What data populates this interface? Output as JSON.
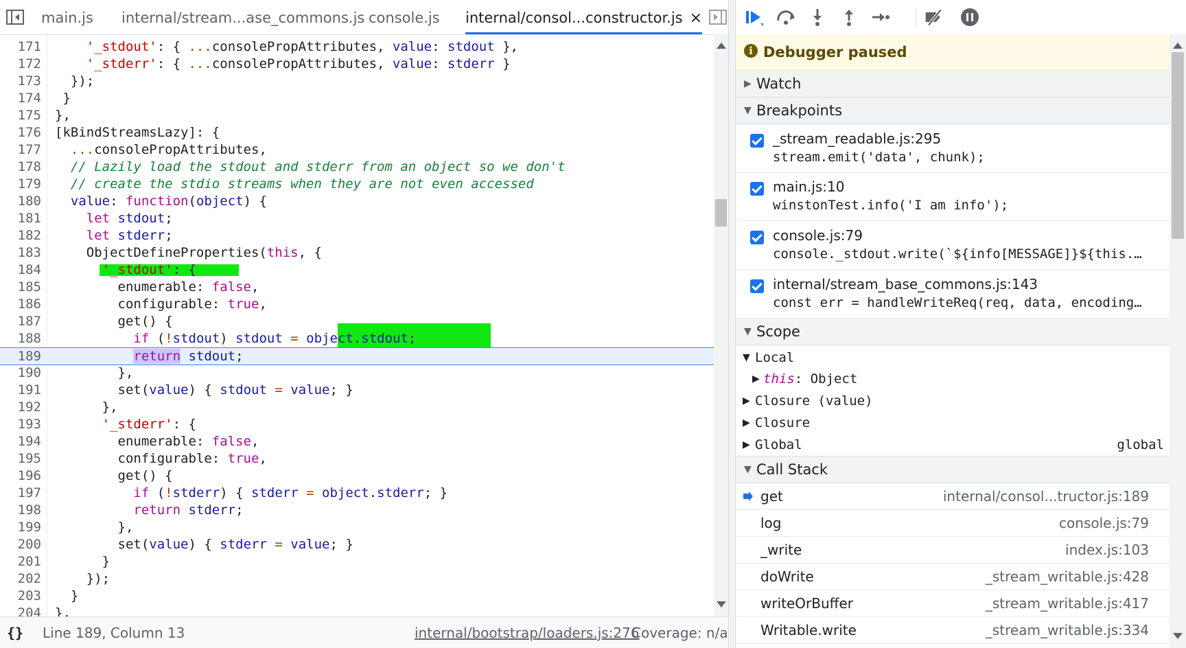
{
  "tabs": [
    {
      "label": "main.js"
    },
    {
      "label": "internal/stream...ase_commons.js"
    },
    {
      "label": "console.js"
    },
    {
      "label": "internal/consol...constructor.js",
      "close": "×"
    }
  ],
  "code_lines": [
    {
      "n": "171",
      "text": "    '_stdout': { ...consolePropAttributes, value: stdout },"
    },
    {
      "n": "172",
      "text": "    '_stderr': { ...consolePropAttributes, value: stderr }"
    },
    {
      "n": "173",
      "text": "  });"
    },
    {
      "n": "174",
      "text": " }"
    },
    {
      "n": "175",
      "text": "},"
    },
    {
      "n": "176",
      "text": "[kBindStreamsLazy]: {"
    },
    {
      "n": "177",
      "text": "  ...consolePropAttributes,"
    },
    {
      "n": "178",
      "text": "  // Lazily load the stdout and stderr from an object so we don't"
    },
    {
      "n": "179",
      "text": "  // create the stdio streams when they are not even accessed"
    },
    {
      "n": "180",
      "text": "  value: function(object) {"
    },
    {
      "n": "181",
      "text": "    let stdout;"
    },
    {
      "n": "182",
      "text": "    let stderr;"
    },
    {
      "n": "183",
      "text": "    ObjectDefineProperties(this, {"
    },
    {
      "n": "184",
      "text": "      '_stdout': {"
    },
    {
      "n": "185",
      "text": "        enumerable: false,"
    },
    {
      "n": "186",
      "text": "        configurable: true,"
    },
    {
      "n": "187",
      "text": "        get() {"
    },
    {
      "n": "188",
      "text": "          if (!stdout) stdout = object.stdout;"
    },
    {
      "n": "189",
      "text": "          return stdout;"
    },
    {
      "n": "190",
      "text": "        },"
    },
    {
      "n": "191",
      "text": "        set(value) { stdout = value; }"
    },
    {
      "n": "192",
      "text": "      },"
    },
    {
      "n": "193",
      "text": "      '_stderr': {"
    },
    {
      "n": "194",
      "text": "        enumerable: false,"
    },
    {
      "n": "195",
      "text": "        configurable: true,"
    },
    {
      "n": "196",
      "text": "        get() {"
    },
    {
      "n": "197",
      "text": "          if (!stderr) { stderr = object.stderr; }"
    },
    {
      "n": "198",
      "text": "          return stderr;"
    },
    {
      "n": "199",
      "text": "        },"
    },
    {
      "n": "200",
      "text": "        set(value) { stderr = value; }"
    },
    {
      "n": "201",
      "text": "      }"
    },
    {
      "n": "202",
      "text": "    });"
    },
    {
      "n": "203",
      "text": "  }"
    },
    {
      "n": "204",
      "text": "},"
    }
  ],
  "status": {
    "braces": "{}",
    "position": "Line 189, Column 13",
    "source_link": "internal/bootstrap/loaders.js:276",
    "coverage": "Coverage: n/a"
  },
  "debugger": {
    "paused_text": "Debugger paused",
    "info_glyph": "i",
    "sections": {
      "watch": "Watch",
      "breakpoints": "Breakpoints",
      "scope": "Scope",
      "call_stack": "Call Stack"
    },
    "breakpoints": [
      {
        "file": "_stream_readable.js:295",
        "snippet": "stream.emit('data', chunk);"
      },
      {
        "file": "main.js:10",
        "snippet": "winstonTest.info('I am info');"
      },
      {
        "file": "console.js:79",
        "snippet": "console._stdout.write(`${info[MESSAGE]}${this.…"
      },
      {
        "file": "internal/stream_base_commons.js:143",
        "snippet": "const err = handleWriteReq(req, data, encoding…"
      }
    ],
    "scope": {
      "local": "Local",
      "this_kw": "this",
      "this_val": ": Object",
      "closure_value": "Closure (value)",
      "closure": "Closure",
      "global": "Global",
      "global_val": "global"
    },
    "call_stack": [
      {
        "fn": "get",
        "loc": "internal/consol...tructor.js:189",
        "current": true
      },
      {
        "fn": "log",
        "loc": "console.js:79"
      },
      {
        "fn": "_write",
        "loc": "index.js:103"
      },
      {
        "fn": "doWrite",
        "loc": "_stream_writable.js:428"
      },
      {
        "fn": "writeOrBuffer",
        "loc": "_stream_writable.js:417"
      },
      {
        "fn": "Writable.write",
        "loc": "_stream_writable.js:334"
      }
    ]
  },
  "colors": {
    "accent": "#1a73e8",
    "highlight_green": "#11e811",
    "paused_bg": "#fffbe6"
  }
}
